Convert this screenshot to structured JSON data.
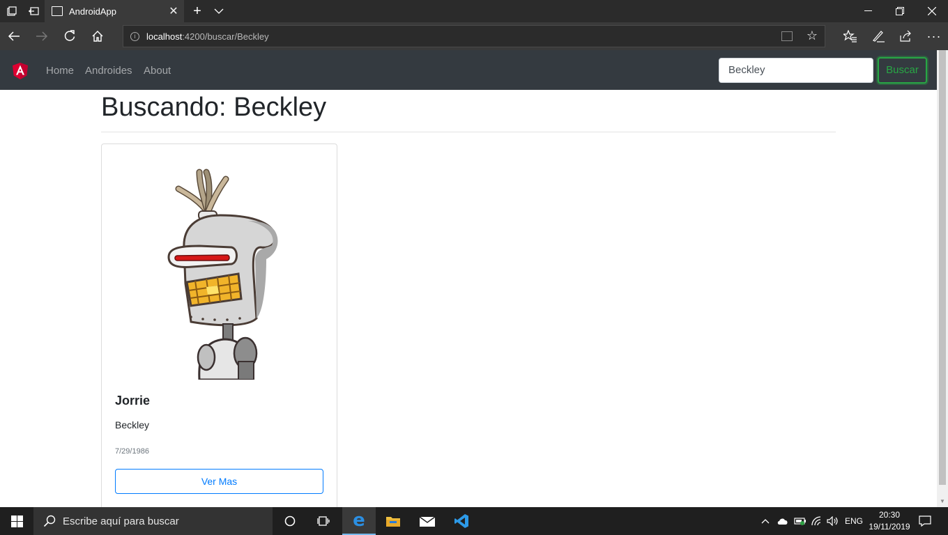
{
  "browser": {
    "tab_title": "AndroidApp",
    "url_host": "localhost",
    "url_path": ":4200/buscar/Beckley"
  },
  "navbar": {
    "links": [
      "Home",
      "Androides",
      "About"
    ],
    "search_value": "Beckley",
    "search_button": "Buscar"
  },
  "main": {
    "heading": "Buscando: Beckley",
    "cards": [
      {
        "name": "Jorrie",
        "surname": "Beckley",
        "date": "7/29/1986",
        "button": "Ver Mas"
      }
    ]
  },
  "taskbar": {
    "search_placeholder": "Escribe aquí para buscar",
    "language": "ENG",
    "time": "20:30",
    "date": "19/11/2019"
  },
  "colors": {
    "navbar_bg": "#343a40",
    "success": "#28a745",
    "primary": "#007bff",
    "angular_red": "#dd0031"
  },
  "icons": [
    "tab-actions-icon",
    "set-aside-icon",
    "new-tab-icon",
    "tab-list-icon",
    "back-icon",
    "forward-icon",
    "refresh-icon",
    "home-icon",
    "info-icon",
    "reading-view-icon",
    "favorite-star-icon",
    "favorites-icon",
    "pen-icon",
    "share-icon",
    "more-icon",
    "windows-start-icon",
    "search-icon",
    "cortana-icon",
    "task-view-icon",
    "edge-icon",
    "file-explorer-icon",
    "mail-icon",
    "vscode-icon",
    "notification-icon"
  ]
}
